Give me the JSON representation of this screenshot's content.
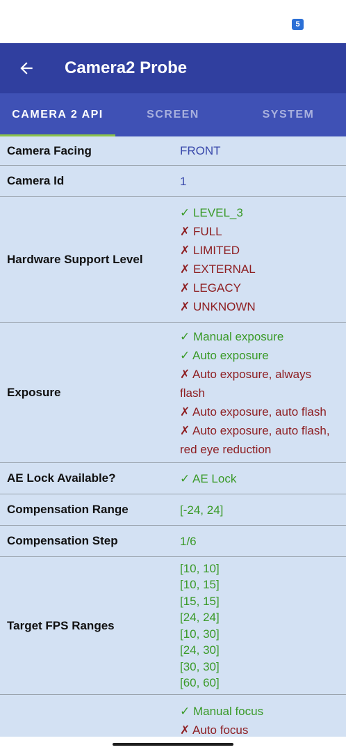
{
  "status_bar": {
    "notification_badge": "5"
  },
  "app_bar": {
    "title": "Camera2 Probe"
  },
  "tabs": [
    {
      "label": "CAMERA 2 API",
      "active": true
    },
    {
      "label": "SCREEN",
      "active": false
    },
    {
      "label": "SYSTEM",
      "active": false
    }
  ],
  "rows": [
    {
      "label": "Camera Facing",
      "values": [
        {
          "text": "FRONT",
          "status": "neutral"
        }
      ]
    },
    {
      "label": "Camera Id",
      "values": [
        {
          "text": "1",
          "status": "neutral"
        }
      ]
    },
    {
      "label": "Hardware Support Level",
      "values": [
        {
          "text": "✓ LEVEL_3",
          "status": "supported"
        },
        {
          "text": "✗ FULL",
          "status": "unsupported"
        },
        {
          "text": "✗ LIMITED",
          "status": "unsupported"
        },
        {
          "text": "✗ EXTERNAL",
          "status": "unsupported"
        },
        {
          "text": "✗ LEGACY",
          "status": "unsupported"
        },
        {
          "text": "✗ UNKNOWN",
          "status": "unsupported"
        }
      ]
    },
    {
      "label": "Exposure",
      "values": [
        {
          "text": "✓ Manual exposure",
          "status": "supported"
        },
        {
          "text": "✓ Auto exposure",
          "status": "supported"
        },
        {
          "text": "✗ Auto exposure, always flash",
          "status": "unsupported"
        },
        {
          "text": "✗ Auto exposure, auto flash",
          "status": "unsupported"
        },
        {
          "text": "✗ Auto exposure, auto flash, red eye reduction",
          "status": "unsupported"
        }
      ]
    },
    {
      "label": "AE Lock Available?",
      "values": [
        {
          "text": "✓ AE Lock",
          "status": "supported"
        }
      ]
    },
    {
      "label": "Compensation Range",
      "values": [
        {
          "text": "[-24, 24]",
          "status": "supported"
        }
      ]
    },
    {
      "label": "Compensation Step",
      "values": [
        {
          "text": "1/6",
          "status": "supported"
        }
      ]
    },
    {
      "label": "Target FPS Ranges",
      "compact": true,
      "values": [
        {
          "text": "[10, 10]",
          "status": "supported"
        },
        {
          "text": "[10, 15]",
          "status": "supported"
        },
        {
          "text": "[15, 15]",
          "status": "supported"
        },
        {
          "text": "[24, 24]",
          "status": "supported"
        },
        {
          "text": "[10, 30]",
          "status": "supported"
        },
        {
          "text": "[24, 30]",
          "status": "supported"
        },
        {
          "text": "[30, 30]",
          "status": "supported"
        },
        {
          "text": "[60, 60]",
          "status": "supported"
        }
      ]
    },
    {
      "label": "",
      "values": [
        {
          "text": "✓ Manual focus",
          "status": "supported"
        },
        {
          "text": "✗ Auto focus",
          "status": "unsupported"
        }
      ]
    }
  ],
  "colors": {
    "app_bar": "#303f9f",
    "tab_bar": "#3f51b5",
    "tab_indicator": "#8bc34a",
    "content_bg": "#d3e1f3",
    "supported": "#3a9a28",
    "unsupported": "#8e1f22",
    "neutral": "#3949ab"
  },
  "icons": {
    "back": "arrow-back-icon"
  }
}
